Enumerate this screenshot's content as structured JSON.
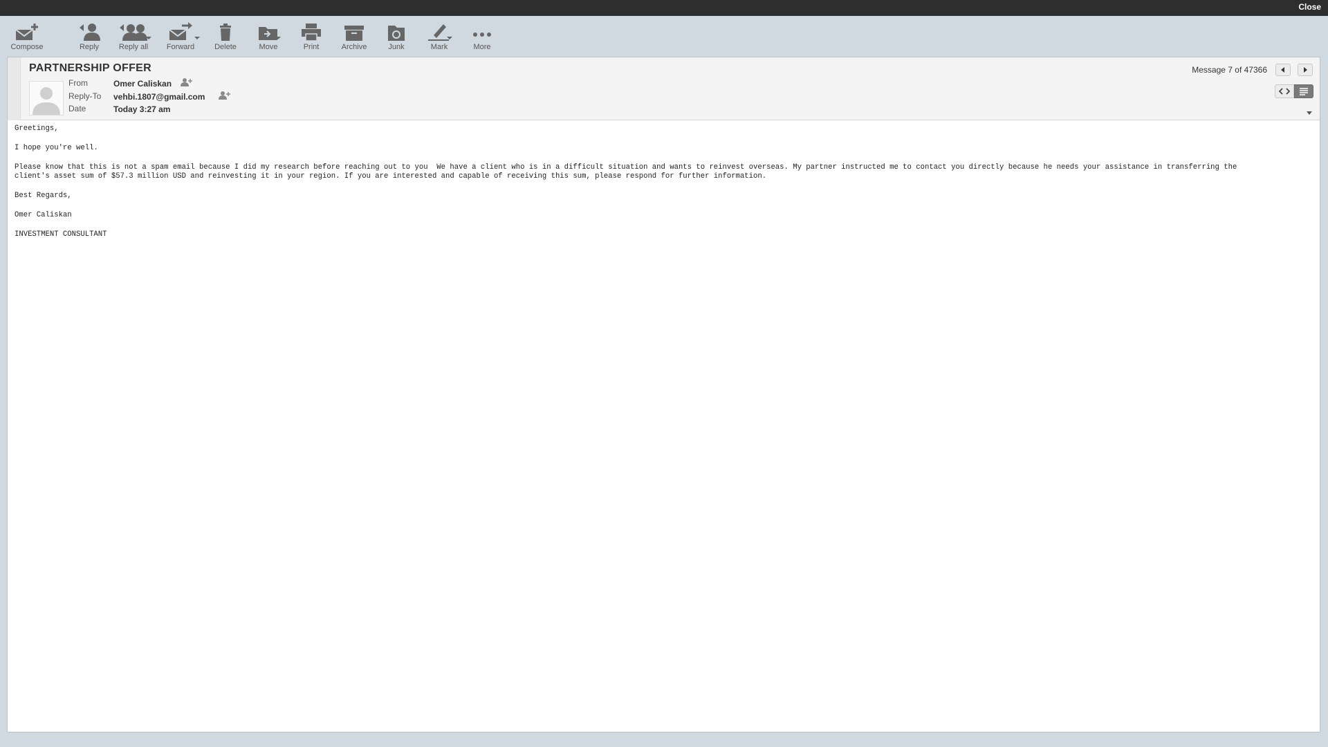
{
  "window": {
    "close_label": "Close"
  },
  "toolbar": {
    "compose": "Compose",
    "reply": "Reply",
    "reply_all": "Reply all",
    "forward": "Forward",
    "delete": "Delete",
    "move": "Move",
    "print": "Print",
    "archive": "Archive",
    "junk": "Junk",
    "mark": "Mark",
    "more": "More"
  },
  "message": {
    "subject": "PARTNERSHIP OFFER",
    "from_label": "From",
    "from_value": "Omer Caliskan",
    "replyto_label": "Reply-To",
    "replyto_value": "vehbi.1807@gmail.com",
    "date_label": "Date",
    "date_value": "Today 3:27 am",
    "counter": "Message 7 of 47366"
  },
  "body": {
    "greeting": "Greetings,",
    "line1": "I hope you're well.",
    "para_line1": "Please know that this is not a spam email because I did my research before reaching out to you  We have a client who is in a difficult situation and wants to reinvest overseas. My partner instructed me to contact you directly because he needs your assistance in transferring the",
    "para_line2": "client's asset sum of $57.3 million USD and reinvesting it in your region. If you are interested and capable of receiving this sum, please respond for further information.",
    "closing": "Best Regards,",
    "signature": "Omer Caliskan",
    "title": "INVESTMENT CONSULTANT"
  },
  "colors": {
    "toolbar_bg": "#d0d9e0",
    "topbar_bg": "#2e2e2e",
    "icon": "#666666"
  },
  "icons": [
    "compose-icon",
    "reply-icon",
    "reply-all-icon",
    "forward-icon",
    "delete-icon",
    "move-icon",
    "print-icon",
    "archive-icon",
    "junk-icon",
    "mark-icon",
    "more-icon",
    "add-contact-icon",
    "prev-arrow-icon",
    "next-arrow-icon",
    "html-view-icon",
    "plain-view-icon",
    "avatar-icon",
    "chevron-down-icon"
  ]
}
